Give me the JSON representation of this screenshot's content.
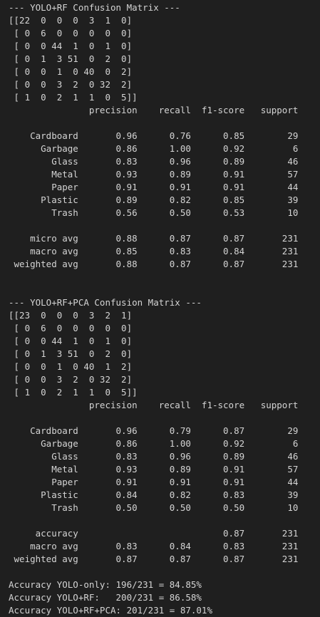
{
  "output": {
    "lines": [
      "--- YOLO+RF Confusion Matrix ---",
      "[[22  0  0  0  3  1  0]",
      " [ 0  6  0  0  0  0  0]",
      " [ 0  0 44  1  0  1  0]",
      " [ 0  1  3 51  0  2  0]",
      " [ 0  0  1  0 40  0  2]",
      " [ 0  0  3  2  0 32  2]",
      " [ 1  0  2  1  1  0  5]]",
      "               precision    recall  f1-score   support",
      "",
      "    Cardboard       0.96      0.76      0.85        29",
      "      Garbage       0.86      1.00      0.92         6",
      "        Glass       0.83      0.96      0.89        46",
      "        Metal       0.93      0.89      0.91        57",
      "        Paper       0.91      0.91      0.91        44",
      "      Plastic       0.89      0.82      0.85        39",
      "        Trash       0.56      0.50      0.53        10",
      "",
      "    micro avg       0.88      0.87      0.87       231",
      "    macro avg       0.85      0.83      0.84       231",
      " weighted avg       0.88      0.87      0.87       231",
      "",
      "",
      "--- YOLO+RF+PCA Confusion Matrix ---",
      "[[23  0  0  0  3  2  1]",
      " [ 0  6  0  0  0  0  0]",
      " [ 0  0 44  1  0  1  0]",
      " [ 0  1  3 51  0  2  0]",
      " [ 0  0  1  0 40  1  2]",
      " [ 0  0  3  2  0 32  2]",
      " [ 1  0  2  1  1  0  5]]",
      "               precision    recall  f1-score   support",
      "",
      "    Cardboard       0.96      0.79      0.87        29",
      "      Garbage       0.86      1.00      0.92         6",
      "        Glass       0.83      0.96      0.89        46",
      "        Metal       0.93      0.89      0.91        57",
      "        Paper       0.91      0.91      0.91        44",
      "      Plastic       0.84      0.82      0.83        39",
      "        Trash       0.50      0.50      0.50        10",
      "",
      "     accuracy                           0.87       231",
      "    macro avg       0.83      0.84      0.83       231",
      " weighted avg       0.87      0.87      0.87       231",
      "",
      "Accuracy YOLO-only: 196/231 = 84.85%",
      "Accuracy YOLO+RF:   200/231 = 86.58%",
      "Accuracy YOLO+RF+PCA: 201/231 = 87.01%"
    ]
  },
  "colors": {
    "background": "#1f1f1f",
    "text": "#d4d4d4"
  }
}
